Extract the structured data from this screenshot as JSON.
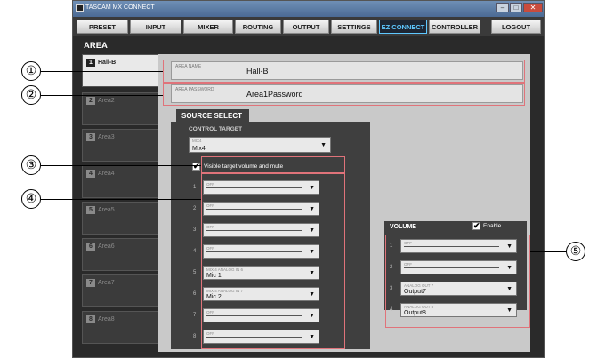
{
  "window": {
    "title": "TASCAM MX CONNECT"
  },
  "menu": {
    "tabs": [
      {
        "label": "PRESET"
      },
      {
        "label": "INPUT"
      },
      {
        "label": "MIXER"
      },
      {
        "label": "ROUTING"
      },
      {
        "label": "OUTPUT"
      },
      {
        "label": "SETTINGS"
      },
      {
        "label": "EZ CONNECT"
      },
      {
        "label": "CONTROLLER"
      },
      {
        "label": "LOGOUT"
      }
    ],
    "active": "EZ CONNECT"
  },
  "area": {
    "title": "AREA",
    "items": [
      {
        "num": "1",
        "label": "Hall-B"
      },
      {
        "num": "2",
        "label": "Area2"
      },
      {
        "num": "3",
        "label": "Area3"
      },
      {
        "num": "4",
        "label": "Area4"
      },
      {
        "num": "5",
        "label": "Area5"
      },
      {
        "num": "6",
        "label": "Area6"
      },
      {
        "num": "7",
        "label": "Area7"
      },
      {
        "num": "8",
        "label": "Area8"
      }
    ]
  },
  "area_name": {
    "label": "AREA NAME",
    "value": "Hall-B"
  },
  "area_password": {
    "label": "AREA PASSWORD",
    "value": "Area1Password"
  },
  "source_select": {
    "title": "SOURCE SELECT",
    "control_target": {
      "label": "CONTROL TARGET",
      "sub": "MIX4",
      "value": "Mix4"
    },
    "visible_target": {
      "label": "Visible target volume and mute",
      "checked": true
    },
    "sources": [
      {
        "n": "1",
        "sub": "OFF",
        "value": ""
      },
      {
        "n": "2",
        "sub": "OFF",
        "value": ""
      },
      {
        "n": "3",
        "sub": "OFF",
        "value": ""
      },
      {
        "n": "4",
        "sub": "OFF",
        "value": ""
      },
      {
        "n": "5",
        "sub": "MIX 4 ANALOG IN 6",
        "value": "Mic 1"
      },
      {
        "n": "6",
        "sub": "MIX 4 ANALOG IN 7",
        "value": "Mic 2"
      },
      {
        "n": "7",
        "sub": "OFF",
        "value": ""
      },
      {
        "n": "8",
        "sub": "OFF",
        "value": ""
      }
    ]
  },
  "volume": {
    "title": "VOLUME",
    "enable_label": "Enable",
    "enabled": true,
    "outputs": [
      {
        "n": "1",
        "sub": "OFF",
        "value": ""
      },
      {
        "n": "2",
        "sub": "OFF",
        "value": ""
      },
      {
        "n": "3",
        "sub": "ANALOG OUT 7",
        "value": "Output7"
      },
      {
        "n": "4",
        "sub": "ANALOG OUT 8",
        "value": "Output8"
      }
    ]
  },
  "callouts": [
    "①",
    "②",
    "③",
    "④",
    "⑤"
  ],
  "colors": {
    "highlight": "#e0737a",
    "active_tab_text": "#5fc8ff"
  }
}
